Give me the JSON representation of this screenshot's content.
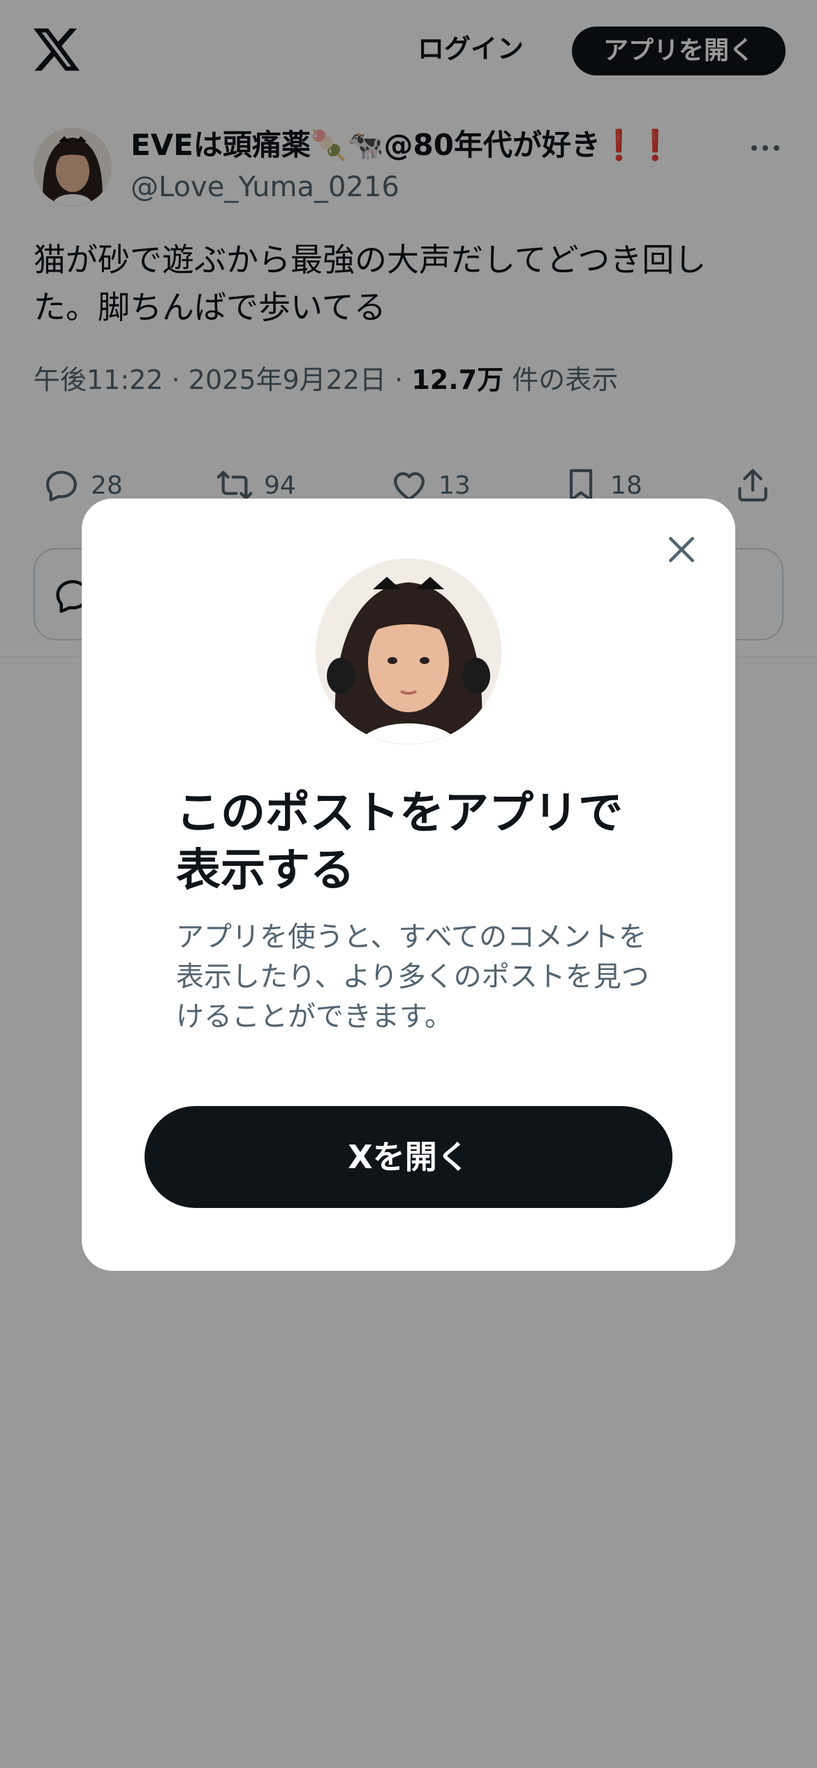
{
  "header": {
    "logo_icon": "x-logo-icon",
    "login_label": "ログイン",
    "open_app_label": "アプリを開く"
  },
  "tweet": {
    "author": {
      "name_prefix": "EVEは頭痛薬",
      "name_emoji_1": "🍡",
      "name_emoji_2": "🐄",
      "name_suffix": "@80年代が好き",
      "name_exclaim": "❗❗",
      "handle": "@Love_Yuma_0216"
    },
    "text": "猫が砂で遊ぶから最強の大声だしてどつき回した。脚ちんばで歩いてる",
    "time": "午後11:22",
    "date": "2025年9月22日",
    "separator": "·",
    "views_count": "12.7万",
    "views_label": "件の表示"
  },
  "actions": {
    "reply": {
      "icon": "reply-icon",
      "count": "28"
    },
    "retweet": {
      "icon": "retweet-icon",
      "count": "94"
    },
    "like": {
      "icon": "heart-icon",
      "count": "13"
    },
    "bookmark": {
      "icon": "bookmark-icon",
      "count": "18"
    },
    "share": {
      "icon": "share-icon"
    }
  },
  "modal": {
    "title": "このポストをアプリで表示する",
    "description": "アプリを使うと、すべてのコメントを表示したり、より多くのポストを見つけることができます。",
    "button_label": "Xを開く",
    "close_icon": "close-icon"
  },
  "colors": {
    "text_primary": "#0f1419",
    "text_secondary": "#536471",
    "button_bg": "#0f1419",
    "overlay": "rgba(0,0,0,0.4)",
    "exclaim_red": "#d0102e"
  }
}
